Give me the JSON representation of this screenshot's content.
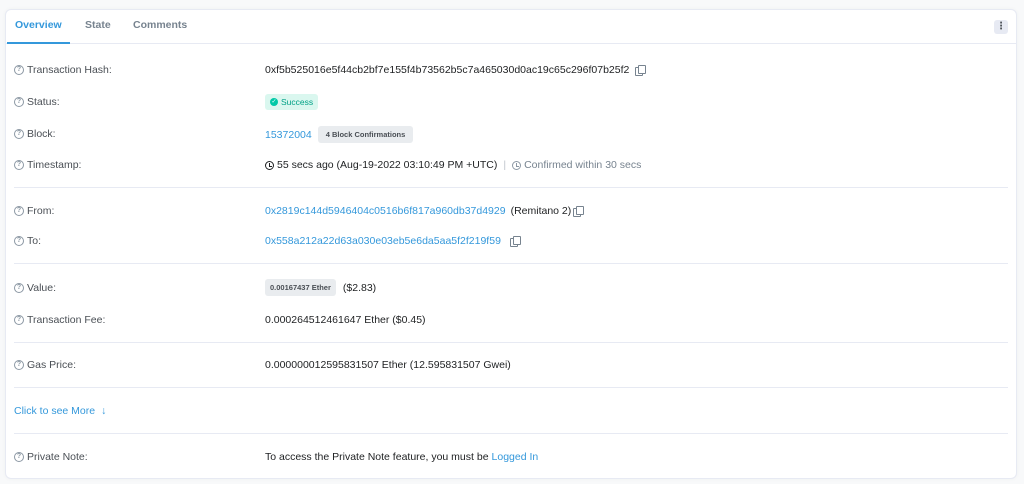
{
  "tabs": [
    {
      "label": "Overview"
    },
    {
      "label": "State"
    },
    {
      "label": "Comments"
    }
  ],
  "menu_icon": "⋮",
  "rows": {
    "tx_hash": {
      "label": "Transaction Hash:",
      "value": "0xf5b525016e5f44cb2bf7e155f4b73562b5c7a465030d0ac19c65c296f07b25f2"
    },
    "status": {
      "label": "Status:",
      "value": "Success"
    },
    "block": {
      "label": "Block:",
      "value": "15372004",
      "confirmations": "4 Block Confirmations"
    },
    "timestamp": {
      "label": "Timestamp:",
      "value": "55 secs ago (Aug-19-2022 03:10:49 PM +UTC)",
      "separator": "|",
      "confirmed": "Confirmed within 30 secs"
    },
    "from": {
      "label": "From:",
      "address": "0x2819c144d5946404c0516b6f817a960db37d4929",
      "name": "(Remitano 2)"
    },
    "to": {
      "label": "To:",
      "address": "0x558a212a22d63a030e03eb5e6da5aa5f2f219f59"
    },
    "value": {
      "label": "Value:",
      "amount": "0.00167437 Ether",
      "usd": "($2.83)"
    },
    "fee": {
      "label": "Transaction Fee:",
      "value": "0.000264512461647 Ether ($0.45)"
    },
    "gas": {
      "label": "Gas Price:",
      "value": "0.000000012595831507 Ether (12.595831507 Gwei)"
    },
    "note": {
      "label": "Private Note:",
      "text": "To access the Private Note feature, you must be",
      "link": "Logged In"
    }
  },
  "see_more": {
    "label": "Click to see More",
    "arrow": "↓"
  },
  "help_glyph": "?",
  "colors": {
    "accent": "#3498db",
    "success": "#00a186",
    "success_bg": "#daf7ef"
  }
}
